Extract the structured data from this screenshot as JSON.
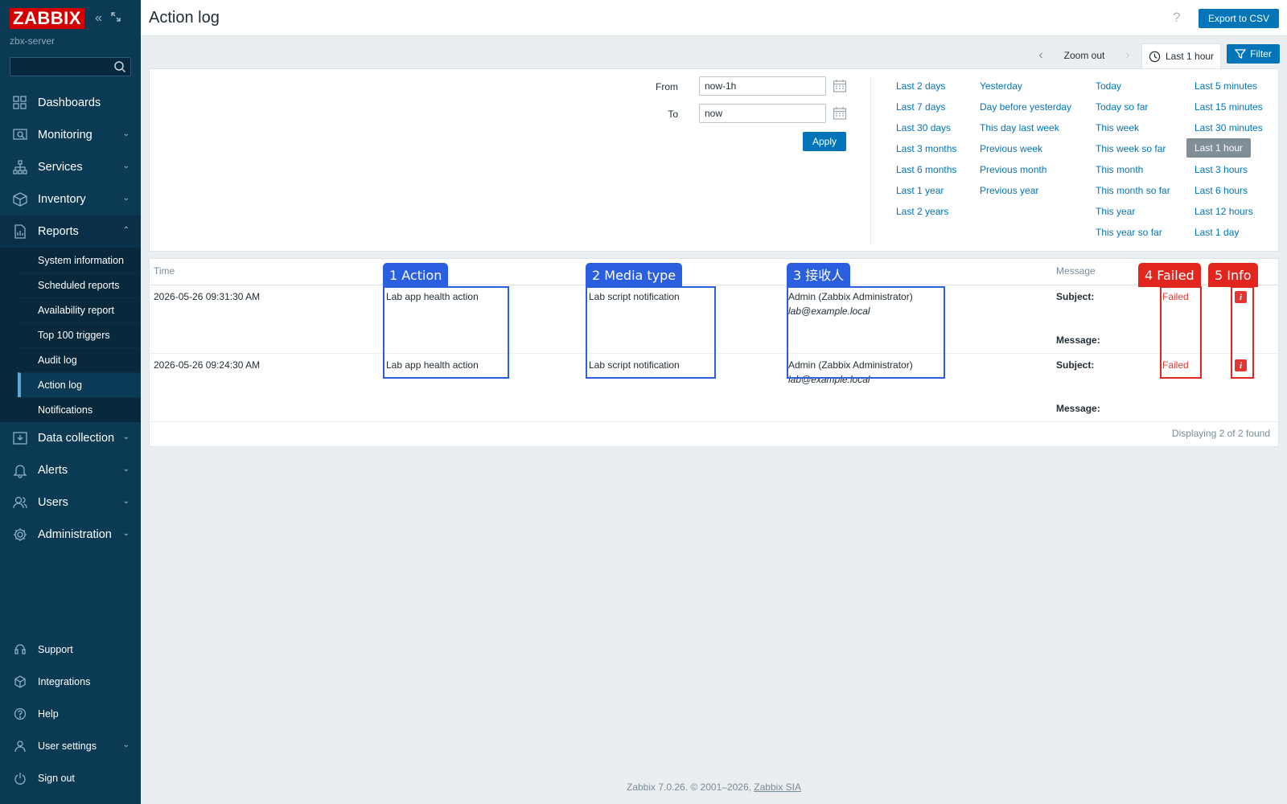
{
  "sidebar": {
    "logo": "ZABBIX",
    "server": "zbx-server",
    "search_placeholder": "",
    "items": [
      {
        "label": "Dashboards",
        "icon": "dashboards-icon"
      },
      {
        "label": "Monitoring",
        "icon": "monitoring-icon"
      },
      {
        "label": "Services",
        "icon": "services-icon"
      },
      {
        "label": "Inventory",
        "icon": "inventory-icon"
      },
      {
        "label": "Reports",
        "icon": "reports-icon"
      },
      {
        "label": "Data collection",
        "icon": "data-collection-icon"
      },
      {
        "label": "Alerts",
        "icon": "alerts-icon"
      },
      {
        "label": "Users",
        "icon": "users-icon"
      },
      {
        "label": "Administration",
        "icon": "administration-icon"
      }
    ],
    "reports_sub": [
      "System information",
      "Scheduled reports",
      "Availability report",
      "Top 100 triggers",
      "Audit log",
      "Action log",
      "Notifications"
    ],
    "bottom": [
      {
        "label": "Support",
        "icon": "support-icon"
      },
      {
        "label": "Integrations",
        "icon": "integrations-icon"
      },
      {
        "label": "Help",
        "icon": "help-icon"
      },
      {
        "label": "User settings",
        "icon": "user-settings-icon"
      },
      {
        "label": "Sign out",
        "icon": "sign-out-icon"
      }
    ]
  },
  "header": {
    "title": "Action log",
    "help": "?",
    "export_label": "Export to CSV"
  },
  "filter_tabs": {
    "zoom_out": "Zoom out",
    "time_label": "Last 1 hour",
    "filter_label": "Filter"
  },
  "filter": {
    "from_label": "From",
    "from_value": "now-1h",
    "to_label": "To",
    "to_value": "now",
    "apply_label": "Apply",
    "quick": {
      "col1": [
        "Last 2 days",
        "Last 7 days",
        "Last 30 days",
        "Last 3 months",
        "Last 6 months",
        "Last 1 year",
        "Last 2 years"
      ],
      "col2": [
        "Yesterday",
        "Day before yesterday",
        "This day last week",
        "Previous week",
        "Previous month",
        "Previous year"
      ],
      "col3": [
        "Today",
        "Today so far",
        "This week",
        "This week so far",
        "This month",
        "This month so far",
        "This year",
        "This year so far"
      ],
      "col4": [
        "Last 5 minutes",
        "Last 15 minutes",
        "Last 30 minutes",
        "Last 1 hour",
        "Last 3 hours",
        "Last 6 hours",
        "Last 12 hours",
        "Last 1 day"
      ]
    },
    "selected": "Last 1 hour"
  },
  "table": {
    "headers": {
      "time": "Time",
      "message": "Message"
    },
    "rows": [
      {
        "time": "2026-05-26 09:31:30 AM",
        "action": "Lab app health action",
        "media": "Lab script notification",
        "recipient_name": "Admin (Zabbix Administrator)",
        "recipient_email": "lab@example.local",
        "subject_label": "Subject:",
        "message_label": "Message:",
        "status": "Failed",
        "info": "i"
      },
      {
        "time": "2026-05-26 09:24:30 AM",
        "action": "Lab app health action",
        "media": "Lab script notification",
        "recipient_name": "Admin (Zabbix Administrator)",
        "recipient_email": "lab@example.local",
        "subject_label": "Subject:",
        "message_label": "Message:",
        "status": "Failed",
        "info": "i"
      }
    ],
    "footer": "Displaying 2 of 2 found"
  },
  "annotations": {
    "a1": "1 Action",
    "a2": "2 Media type",
    "a3": "3 接收人",
    "a4": "4 Failed",
    "a5": "5 Info"
  },
  "footer": {
    "text": "Zabbix 7.0.26. © 2001–2026, ",
    "link": "Zabbix SIA"
  },
  "colors": {
    "sidebar": "#0b3a55",
    "primary": "#0275b8",
    "logo": "#d40000",
    "failed": "#e33734",
    "anno_blue": "#2a5fe0",
    "anno_red": "#e0261f"
  }
}
